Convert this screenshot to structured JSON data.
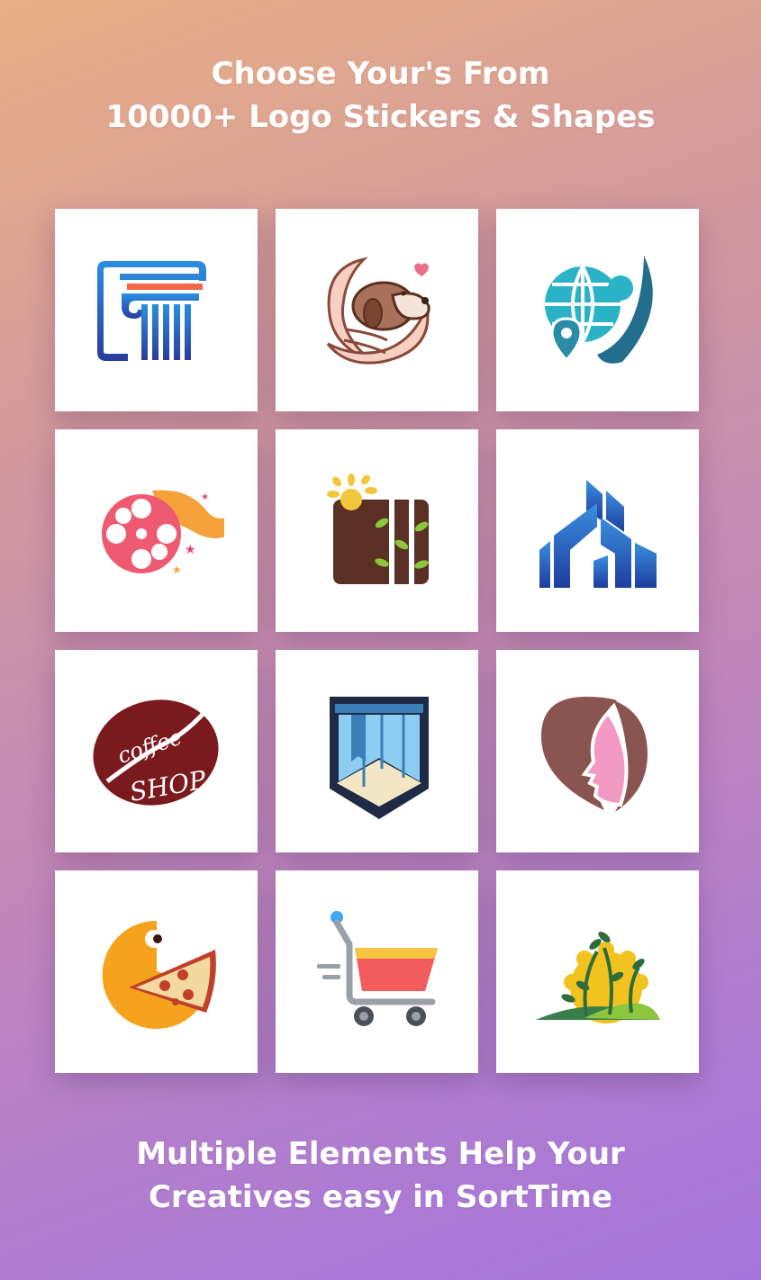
{
  "header": {
    "line1": "Choose Your's From",
    "line2": "10000+ Logo Stickers  & Shapes"
  },
  "footer": {
    "line1": "Multiple Elements Help Your",
    "line2": "Creatives easy in SortTime"
  },
  "logos": [
    {
      "icon": "pillar-logo-icon"
    },
    {
      "icon": "hands-dog-logo-icon"
    },
    {
      "icon": "globe-location-person-logo-icon"
    },
    {
      "icon": "film-reel-logo-icon"
    },
    {
      "icon": "bamboo-sun-logo-icon"
    },
    {
      "icon": "buildings-logo-icon"
    },
    {
      "icon": "coffee-shop-bean-logo-icon",
      "text_top": "coffee",
      "text_bottom": "SHOP"
    },
    {
      "icon": "book-shield-logo-icon"
    },
    {
      "icon": "woman-face-leaf-logo-icon"
    },
    {
      "icon": "pizza-pacman-logo-icon"
    },
    {
      "icon": "shopping-cart-logo-icon"
    },
    {
      "icon": "sprouts-sun-hill-logo-icon"
    }
  ]
}
